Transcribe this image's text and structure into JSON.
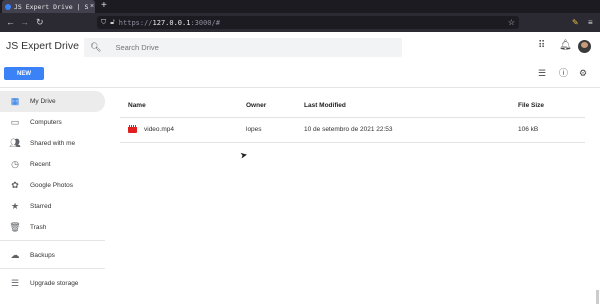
{
  "browser": {
    "tab_title": "JS Expert Drive | Se:",
    "tab_close": "×",
    "new_tab": "+",
    "url_prefix": "https://",
    "url_host": "127.0.0.1",
    "url_rest": ":3000/#"
  },
  "app": {
    "title": "JS Expert Drive",
    "search_placeholder": "Search Drive",
    "new_button": "NEW"
  },
  "sidebar": {
    "items": [
      {
        "label": "My Drive",
        "icon": "drive-grid-icon"
      },
      {
        "label": "Computers",
        "icon": "computer-icon"
      },
      {
        "label": "Shared with me",
        "icon": "people-icon"
      },
      {
        "label": "Recent",
        "icon": "clock-icon"
      },
      {
        "label": "Google Photos",
        "icon": "photos-icon"
      },
      {
        "label": "Starred",
        "icon": "star-icon"
      },
      {
        "label": "Trash",
        "icon": "trash-icon"
      },
      {
        "label": "Backups",
        "icon": "cloud-icon"
      },
      {
        "label": "Upgrade storage",
        "icon": "storage-icon"
      }
    ]
  },
  "table": {
    "columns": [
      "Name",
      "Owner",
      "Last Modified",
      "File Size"
    ],
    "rows": [
      {
        "name": "video.mp4",
        "owner": "lopes",
        "modified": "10 de setembro de 2021 22:53",
        "size": "106 kB"
      }
    ]
  },
  "colors": {
    "accent": "#3b82f6",
    "file_icon": "#e02020"
  }
}
